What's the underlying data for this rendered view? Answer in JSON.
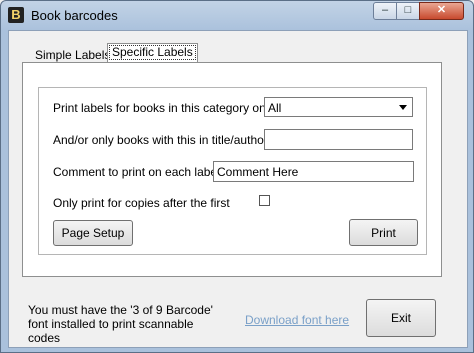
{
  "window": {
    "title": "Book barcodes",
    "icon_glyph": "B",
    "controls": {
      "minimize": "–",
      "maximize": "□",
      "close": "✕"
    }
  },
  "tabs": [
    {
      "label": "Simple Labels",
      "selected": false
    },
    {
      "label": "Specific Labels",
      "selected": true
    }
  ],
  "form": {
    "category_label": "Print labels for books in this category only:",
    "category_value": "All",
    "title_author_label": "And/or only books with this in title/author:",
    "title_author_value": "",
    "comment_label": "Comment to print on each label:",
    "comment_value": "Comment Here",
    "copies_label": "Only print for copies after the first",
    "copies_checked": false
  },
  "buttons": {
    "page_setup": "Page Setup",
    "print": "Print",
    "exit": "Exit"
  },
  "footer": {
    "font_notice": "You must have the '3 of 9 Barcode' font installed to print scannable codes",
    "download_link": "Download font here"
  },
  "icons": [
    "app-icon",
    "chevron-down-icon",
    "minimize-icon",
    "maximize-icon",
    "close-icon"
  ]
}
